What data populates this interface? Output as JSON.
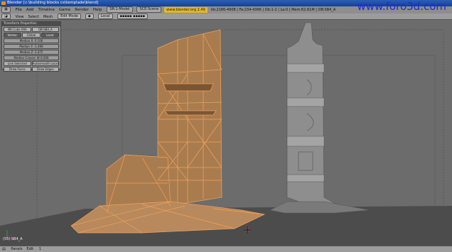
{
  "titlebar": {
    "title": "Blender [c:\\building blocks cs\\templade\\blend]"
  },
  "menubar": {
    "items": [
      "File",
      "Add",
      "Timeline",
      "Game",
      "Render",
      "Help"
    ],
    "screen": "SR:1-Model",
    "scene": "SCE:Scene",
    "url": "www.blender.org 2.49",
    "stats": "Ve:2186-4908 | Fa:234-4366 | Ob:1-2 | La:0 | Mem:62.61M | OB:SB4_A"
  },
  "watermark": "www.foro3d.com",
  "header": {
    "items": [
      "View",
      "Select",
      "Mesh"
    ],
    "mode": "Edit Mode",
    "orientation": "Local"
  },
  "panel": {
    "title": "Transform Properties",
    "mesh_name": "ME:Cube.066",
    "object_name": "OB:SB4_A",
    "vertex_label": "Vertex:",
    "global_button": "Global",
    "local_button": "Local",
    "median_x": "Median X: 0.106",
    "median_y": "Median Y: -1.496",
    "median_z": "Median Z: 3.475",
    "crease": "Median Crease: W 0.000",
    "link_sel": "Link Selected",
    "auto_smooth": "Autosmooth Local",
    "draw_faces": "Draw Faces",
    "draw_edges": "Draw Edges"
  },
  "viewport": {
    "object_label": "(55) SB4_A"
  },
  "status": {
    "items": [
      "Panels",
      "Edit"
    ],
    "frame": "1"
  }
}
